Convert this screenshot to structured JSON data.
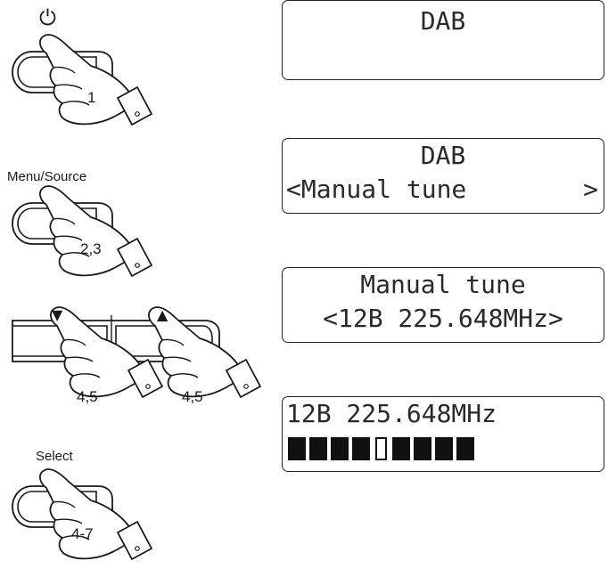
{
  "buttons": {
    "power_symbol": "⏻",
    "power_step": "1",
    "menu_label": "Menu/Source",
    "menu_step": "2,3",
    "down_arrow": "▼",
    "up_arrow": "▲",
    "down_step": "4,5",
    "up_step": "4,5",
    "select_label": "Select",
    "select_step": "4-7"
  },
  "displays": [
    {
      "line1": "DAB",
      "line2": ""
    },
    {
      "line1": "DAB",
      "line2_left": "<Manual tune",
      "line2_right": ">"
    },
    {
      "line1": "Manual tune",
      "line2": "<12B 225.648MHz>"
    },
    {
      "line1": "12B 225.648MHz",
      "signal_segments": 9,
      "signal_marker_index": 4
    }
  ]
}
